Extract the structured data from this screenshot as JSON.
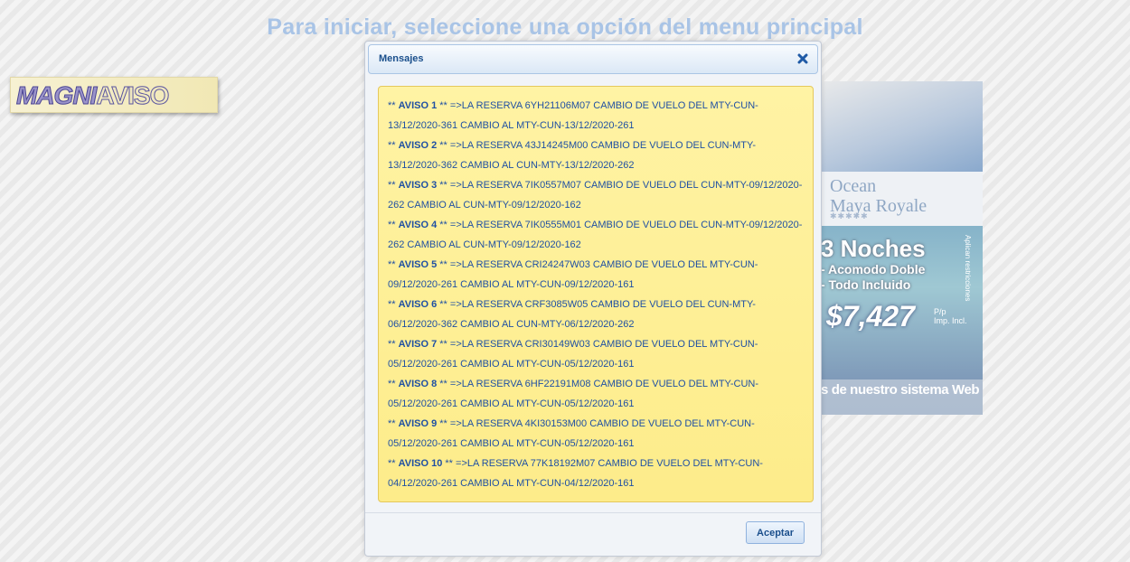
{
  "page": {
    "heading": "Para iniciar, seleccione una opción del menu principal"
  },
  "logo": {
    "part1": "MAGNI",
    "part2": "AVISO"
  },
  "ad": {
    "brand_name": "Ocean\nMaya Royale",
    "stars": "✱✱✱✱✱",
    "nights": "3 Noches",
    "line1": "- Acomodo Doble",
    "line2": "- Todo Incluido",
    "side_text": "Aplican restricciones",
    "price": "$7,427",
    "price_note": "P/p\nImp. Incl.",
    "footer": "s de nuestro sistema Web"
  },
  "dialog": {
    "title": "Mensajes",
    "messages": [
      {
        "label": "AVISO 1",
        "text": "=>LA RESERVA 6YH21106M07 CAMBIO DE VUELO DEL MTY-CUN-13/12/2020-361 CAMBIO AL MTY-CUN-13/12/2020-261"
      },
      {
        "label": "AVISO 2",
        "text": "=>LA RESERVA 43J14245M00 CAMBIO DE VUELO DEL CUN-MTY-13/12/2020-362 CAMBIO AL CUN-MTY-13/12/2020-262"
      },
      {
        "label": "AVISO 3",
        "text": "=>LA RESERVA 7IK0557M07 CAMBIO DE VUELO DEL CUN-MTY-09/12/2020-262 CAMBIO AL CUN-MTY-09/12/2020-162"
      },
      {
        "label": "AVISO 4",
        "text": "=>LA RESERVA 7IK0555M01 CAMBIO DE VUELO DEL CUN-MTY-09/12/2020-262 CAMBIO AL CUN-MTY-09/12/2020-162"
      },
      {
        "label": "AVISO 5",
        "text": "=>LA RESERVA CRI24247W03 CAMBIO DE VUELO DEL MTY-CUN-09/12/2020-261 CAMBIO AL MTY-CUN-09/12/2020-161"
      },
      {
        "label": "AVISO 6",
        "text": "=>LA RESERVA CRF3085W05 CAMBIO DE VUELO DEL CUN-MTY-06/12/2020-362 CAMBIO AL CUN-MTY-06/12/2020-262"
      },
      {
        "label": "AVISO 7",
        "text": "=>LA RESERVA CRI30149W03 CAMBIO DE VUELO DEL MTY-CUN-05/12/2020-261 CAMBIO AL MTY-CUN-05/12/2020-161"
      },
      {
        "label": "AVISO 8",
        "text": "=>LA RESERVA 6HF22191M08 CAMBIO DE VUELO DEL MTY-CUN-05/12/2020-261 CAMBIO AL MTY-CUN-05/12/2020-161"
      },
      {
        "label": "AVISO 9",
        "text": "=>LA RESERVA 4KI30153M00 CAMBIO DE VUELO DEL MTY-CUN-05/12/2020-261 CAMBIO AL MTY-CUN-05/12/2020-161"
      },
      {
        "label": "AVISO 10",
        "text": "=>LA RESERVA 77K18192M07 CAMBIO DE VUELO DEL MTY-CUN-04/12/2020-261 CAMBIO AL MTY-CUN-04/12/2020-161"
      }
    ],
    "accept_label": "Aceptar",
    "close_icon": "close-icon"
  },
  "colors": {
    "heading": "#a9c4e6",
    "message_text": "#1f50a3",
    "message_bg": "#fdec8a",
    "title_text": "#1a4f8c"
  }
}
